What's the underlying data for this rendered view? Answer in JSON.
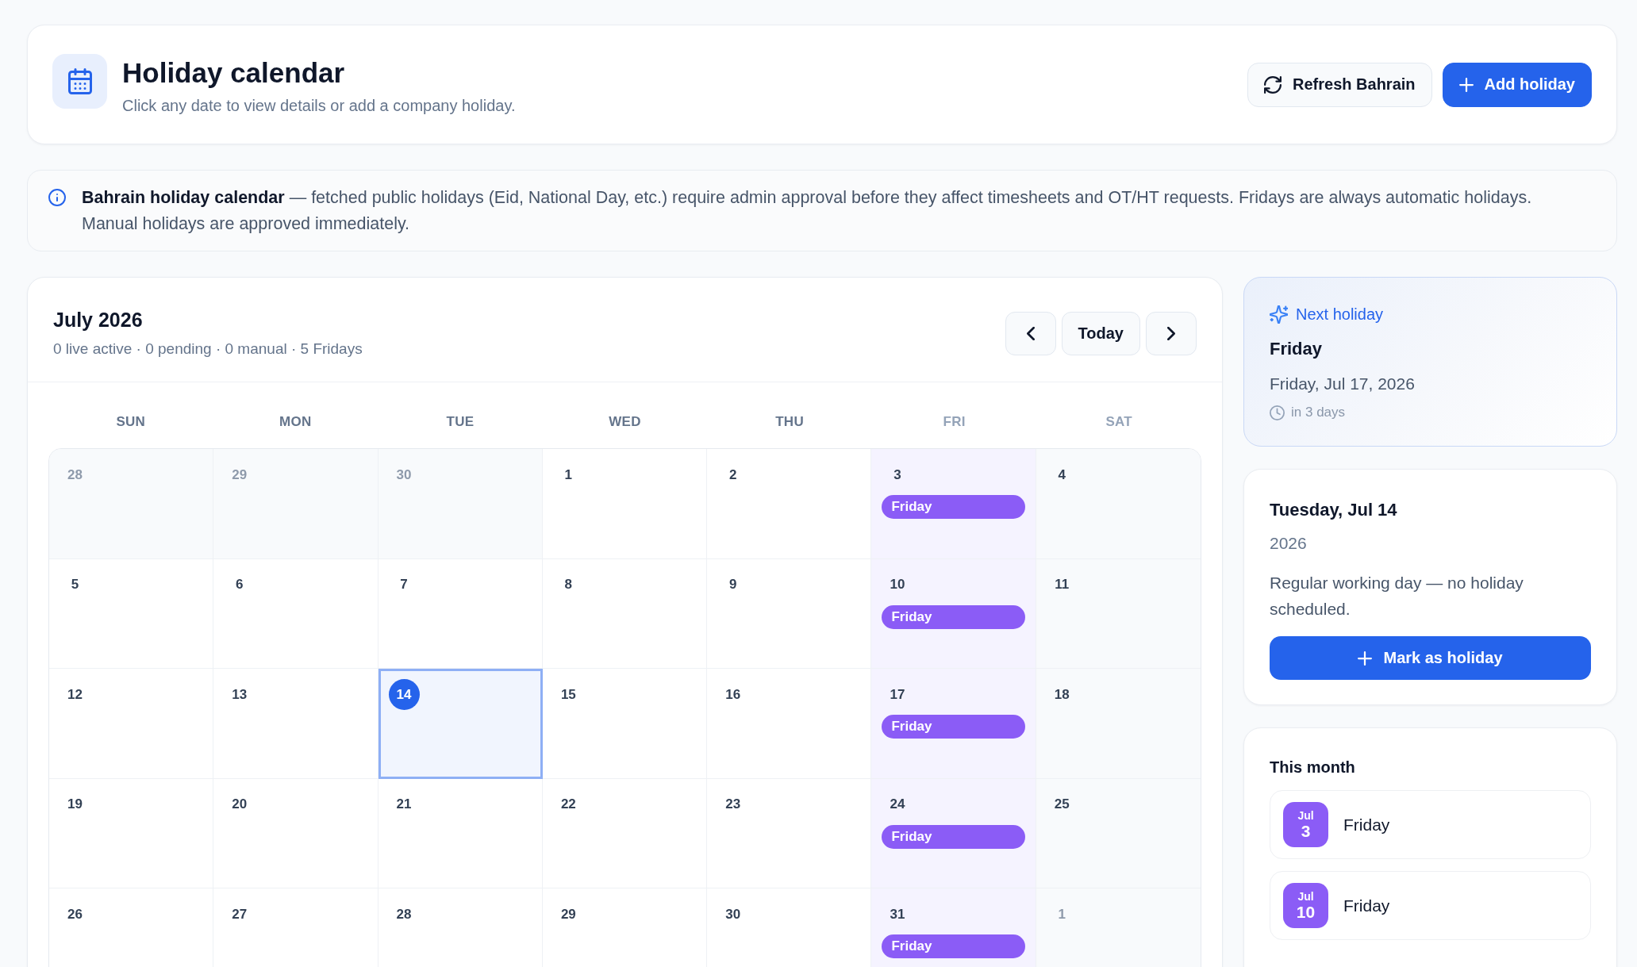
{
  "header": {
    "title": "Holiday calendar",
    "subtitle": "Click any date to view details or add a company holiday.",
    "actions": [
      {
        "kind": "refresh",
        "label": "Refresh Bahrain"
      },
      {
        "kind": "add",
        "label": "Add holiday"
      }
    ]
  },
  "notice": {
    "text": "**Bahrain holiday calendar** — fetched public holidays (Eid, National Day, etc.) require admin approval before they affect timesheets and OT/HT requests. Fridays are always automatic holidays. Manual holidays are approved immediately."
  },
  "calendar": {
    "title": "July 2026",
    "summary": "0 live active · 0 pending · 0 manual · 5 Fridays",
    "today_button": "Today",
    "weekdays": [
      {
        "label": "SUN",
        "weekend": false
      },
      {
        "label": "MON",
        "weekend": false
      },
      {
        "label": "TUE",
        "weekend": false
      },
      {
        "label": "WED",
        "weekend": false
      },
      {
        "label": "THU",
        "weekend": false
      },
      {
        "label": "FRI",
        "weekend": true
      },
      {
        "label": "SAT",
        "weekend": true
      }
    ],
    "weeks": [
      [
        {
          "day": "28",
          "outside": true,
          "selected": false,
          "today": false
        },
        {
          "day": "29",
          "outside": true,
          "selected": false,
          "today": false
        },
        {
          "day": "30",
          "outside": true,
          "selected": false,
          "today": false
        },
        {
          "day": "1",
          "outside": false,
          "selected": false,
          "today": false
        },
        {
          "day": "2",
          "outside": false,
          "selected": false,
          "today": false
        },
        {
          "day": "3",
          "outside": false,
          "selected": false,
          "today": false,
          "holidays": [
            "Friday"
          ]
        },
        {
          "day": "4",
          "outside": false,
          "selected": false,
          "today": false
        }
      ],
      [
        {
          "day": "5",
          "outside": false,
          "selected": false,
          "today": false
        },
        {
          "day": "6",
          "outside": false,
          "selected": false,
          "today": false
        },
        {
          "day": "7",
          "outside": false,
          "selected": false,
          "today": false
        },
        {
          "day": "8",
          "outside": false,
          "selected": false,
          "today": false
        },
        {
          "day": "9",
          "outside": false,
          "selected": false,
          "today": false
        },
        {
          "day": "10",
          "outside": false,
          "selected": false,
          "today": false,
          "holidays": [
            "Friday"
          ]
        },
        {
          "day": "11",
          "outside": false,
          "selected": false,
          "today": false
        }
      ],
      [
        {
          "day": "12",
          "outside": false,
          "selected": false,
          "today": false
        },
        {
          "day": "13",
          "outside": false,
          "selected": false,
          "today": false
        },
        {
          "day": "14",
          "outside": false,
          "selected": true,
          "today": true
        },
        {
          "day": "15",
          "outside": false,
          "selected": false,
          "today": false
        },
        {
          "day": "16",
          "outside": false,
          "selected": false,
          "today": false
        },
        {
          "day": "17",
          "outside": false,
          "selected": false,
          "today": false,
          "holidays": [
            "Friday"
          ]
        },
        {
          "day": "18",
          "outside": false,
          "selected": false,
          "today": false
        }
      ],
      [
        {
          "day": "19",
          "outside": false,
          "selected": false,
          "today": false
        },
        {
          "day": "20",
          "outside": false,
          "selected": false,
          "today": false
        },
        {
          "day": "21",
          "outside": false,
          "selected": false,
          "today": false
        },
        {
          "day": "22",
          "outside": false,
          "selected": false,
          "today": false
        },
        {
          "day": "23",
          "outside": false,
          "selected": false,
          "today": false
        },
        {
          "day": "24",
          "outside": false,
          "selected": false,
          "today": false,
          "holidays": [
            "Friday"
          ]
        },
        {
          "day": "25",
          "outside": false,
          "selected": false,
          "today": false
        }
      ],
      [
        {
          "day": "26",
          "outside": false,
          "selected": false,
          "today": false
        },
        {
          "day": "27",
          "outside": false,
          "selected": false,
          "today": false
        },
        {
          "day": "28",
          "outside": false,
          "selected": false,
          "today": false
        },
        {
          "day": "29",
          "outside": false,
          "selected": false,
          "today": false
        },
        {
          "day": "30",
          "outside": false,
          "selected": false,
          "today": false
        },
        {
          "day": "31",
          "outside": false,
          "selected": false,
          "today": false,
          "holidays": [
            "Friday"
          ]
        },
        {
          "day": "1",
          "outside": true,
          "selected": false,
          "today": false
        }
      ]
    ]
  },
  "next_holiday": {
    "label": "Next holiday",
    "name": "Friday",
    "date": "Friday, Jul 17, 2026",
    "countdown": "in 3 days"
  },
  "selected_day": {
    "title": "Tuesday, Jul 14",
    "year": "2026",
    "message": "Regular working day — no holiday scheduled.",
    "button": "Mark as holiday"
  },
  "this_month": {
    "title": "This month",
    "items": [
      {
        "month": "Jul",
        "day": "3",
        "name": "Friday"
      },
      {
        "month": "Jul",
        "day": "10",
        "name": "Friday"
      }
    ]
  }
}
